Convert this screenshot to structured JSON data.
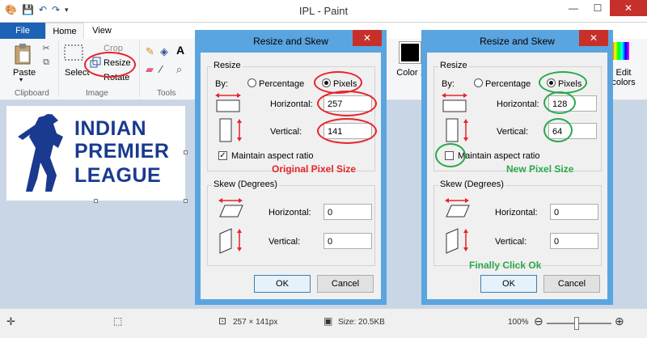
{
  "window": {
    "title": "IPL - Paint"
  },
  "ribbon": {
    "tabs": {
      "file": "File",
      "home": "Home",
      "view": "View"
    },
    "clipboard": {
      "paste": "Paste",
      "group": "Clipboard"
    },
    "image": {
      "select": "Select",
      "crop": "Crop",
      "resize": "Resize",
      "rotate": "Rotate",
      "group": "Image"
    },
    "tools": {
      "group": "Tools"
    },
    "colors": {
      "color1": "Color 1",
      "edit_colors": "Edit colors"
    }
  },
  "canvas": {
    "logo_line1": "INDIAN",
    "logo_line2": "PREMIER",
    "logo_line3": "LEAGUE"
  },
  "status": {
    "dimensions": "257 × 141px",
    "size": "Size: 20.5KB",
    "zoom": "100%"
  },
  "dialog_left": {
    "title": "Resize and Skew",
    "resize_legend": "Resize",
    "by_label": "By:",
    "percentage": "Percentage",
    "pixels": "Pixels",
    "horizontal_label": "Horizontal:",
    "horizontal_value": "257",
    "vertical_label": "Vertical:",
    "vertical_value": "141",
    "maintain": "Maintain aspect ratio",
    "skew_legend": "Skew (Degrees)",
    "skew_h_label": "Horizontal:",
    "skew_h_value": "0",
    "skew_v_label": "Vertical:",
    "skew_v_value": "0",
    "ok": "OK",
    "cancel": "Cancel",
    "annotation": "Original Pixel Size"
  },
  "dialog_right": {
    "title": "Resize and Skew",
    "resize_legend": "Resize",
    "by_label": "By:",
    "percentage": "Percentage",
    "pixels": "Pixels",
    "horizontal_label": "Horizontal:",
    "horizontal_value": "128",
    "vertical_label": "Vertical:",
    "vertical_value": "64",
    "maintain": "Maintain aspect ratio",
    "skew_legend": "Skew (Degrees)",
    "skew_h_label": "Horizontal:",
    "skew_h_value": "0",
    "skew_v_label": "Vertical:",
    "skew_v_value": "0",
    "ok": "OK",
    "cancel": "Cancel",
    "annotation_size": "New Pixel Size",
    "annotation_click": "Finally Click Ok"
  },
  "colors": {
    "annotation_red": "#e8232a",
    "annotation_green": "#2aa84a",
    "dialog_border": "#5aa4e0",
    "logo_blue": "#1a3a8f"
  }
}
